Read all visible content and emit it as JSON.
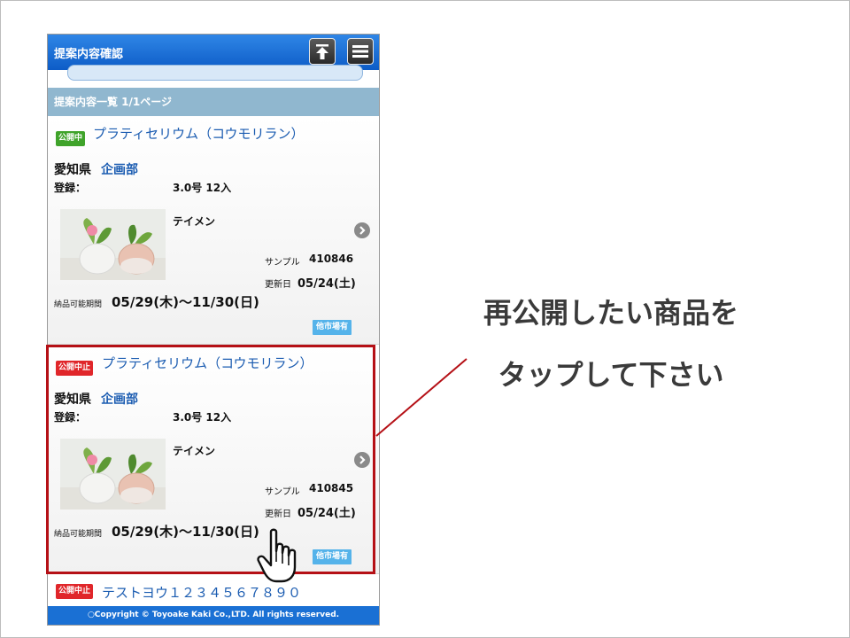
{
  "header": {
    "title": "提案内容確認",
    "up_icon": "upload-arrow-icon",
    "menu_icon": "hamburger-menu-icon"
  },
  "list": {
    "heading": "提案内容一覧 1/1ページ"
  },
  "cards": [
    {
      "status": "公開中",
      "status_color": "#3fa32a",
      "name": "プラティセリウム（コウモリラン）",
      "prefecture": "愛知県",
      "department": "企画部",
      "register_label": "登録：",
      "register_value": "3.0号 12入",
      "variety": "テイメン",
      "sample_label": "サンプル",
      "sample_value": "410846",
      "updated_label": "更新日",
      "updated_value": "05/24(土)",
      "period_label": "納品可能期間",
      "period_value": "05/29(木)～11/30(日)",
      "market_label": "他市場有"
    },
    {
      "status": "公開中止",
      "status_color": "#e0262a",
      "name": "プラティセリウム（コウモリラン）",
      "prefecture": "愛知県",
      "department": "企画部",
      "register_label": "登録：",
      "register_value": "3.0号 12入",
      "variety": "テイメン",
      "sample_label": "サンプル",
      "sample_value": "410845",
      "updated_label": "更新日",
      "updated_value": "05/24(土)",
      "period_label": "納品可能期間",
      "period_value": "05/29(木)～11/30(日)",
      "market_label": "他市場有"
    },
    {
      "status": "公開中止",
      "status_color": "#e0262a",
      "name": "テストヨウ１２３４５６７８９０"
    }
  ],
  "footer": {
    "copyright": "○Copyright © Toyoake Kaki Co.,LTD. All rights reserved."
  },
  "callout": {
    "line1": "再公開したい商品を",
    "line2": "タップして下さい",
    "highlight_color": "#b51016"
  }
}
